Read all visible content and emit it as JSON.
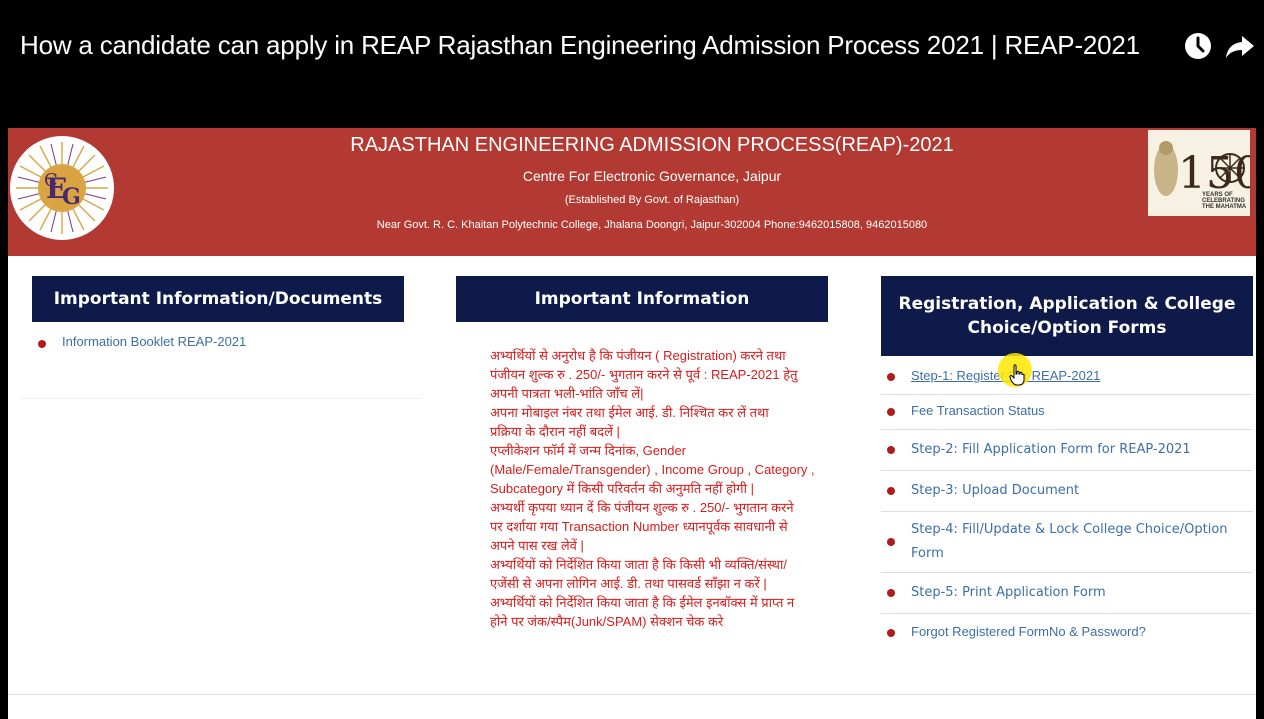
{
  "video": {
    "title": "How a candidate can apply in REAP Rajasthan Engineering Admission Process 2021 | REAP-2021",
    "icons": [
      "clock-icon",
      "share-icon"
    ]
  },
  "banner": {
    "title": "RAJASTHAN ENGINEERING ADMISSION PROCESS(REAP)-2021",
    "subtitle": "Centre For Electronic Governance, Jaipur",
    "established": "(Established By Govt. of Rajasthan)",
    "address": "Near Govt. R. C. Khaitan Polytechnic College, Jhalana Doongri, Jaipur-302004 Phone:9462015808, 9462015080",
    "badge_number": "150",
    "badge_text": [
      "YEARS OF",
      "CELEBRATING",
      "THE MAHATMA"
    ]
  },
  "col1": {
    "heading": "Important Information/Documents",
    "items": [
      "Information Booklet REAP-2021"
    ]
  },
  "col2": {
    "heading": "Important Information",
    "lines": [
      "अभ्यर्थियों से अनुरोध है कि पंजीयन ( Registration) करने तथा",
      "पंजीयन शुल्क रु . 250/- भुगतान करने से पूर्व : REAP-2021 हेतु",
      "अपनी पात्रता भली-भांति जाँच लें|",
      "अपना मोबाइल नंबर तथा ईमेल आई. डी. निश्चित कर लें तथा",
      "प्रक्रिया के दौरान नहीं बदलें |",
      "एप्लीकेशन फॉर्म में जन्म दिनांक, Gender",
      "(Male/Female/Transgender) , Income Group , Category ,",
      "Subcategory में किसी परिवर्तन की अनुमति नहीं होगी |",
      "अभ्यर्थी कृपया ध्यान दें कि पंजीयन शुल्क रु . 250/- भुगतान करने",
      "पर दर्शाया गया Transaction Number ध्यानपूर्वक सावधानी से",
      "अपने पास रख लेवें |",
      "अभ्यर्थियों को निर्देशित किया जाता है कि किसी भी व्यक्ति/संस्था/",
      "एजेंसी से अपना लोगिन आई. डी. तथा पासवर्ड साँझा न करें |",
      "अभ्यर्थियों को निर्देशित किया जाता है कि ईमेल इनबॉक्स में प्राप्त न",
      "होने पर जंक/स्पैम(Junk/SPAM) सेक्शन चेक करे"
    ]
  },
  "col3": {
    "heading": "Registration, Application & College Choice/Option Forms",
    "items": [
      "Step-1: Register For REAP-2021",
      "Fee Transaction Status",
      "Step-2: Fill Application Form for REAP-2021",
      "Step-3: Upload Document",
      "Step-4: Fill/Update & Lock College Choice/Option Form",
      "Step-5: Print Application Form",
      "Forgot Registered FormNo & Password?"
    ]
  },
  "colors": {
    "banner_red": "#b23a32",
    "heading_navy": "#0d1a4a",
    "link_blue": "#3d6ea8",
    "hindi_red": "#d81c1c",
    "bullet": "#b01c1c"
  }
}
